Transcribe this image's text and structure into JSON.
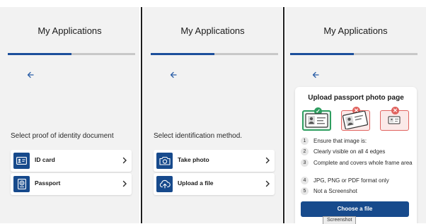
{
  "app": {
    "title": "My Applications"
  },
  "colors": {
    "primary": "#174a8c",
    "progress_track": "#c8c8c8",
    "success": "#2e9e60",
    "error": "#e0635f",
    "background": "#f2f2f2"
  },
  "screens": [
    {
      "progress": 0.5,
      "back_icon": "arrow-left-icon",
      "prompt": "Select proof of identity document",
      "options": [
        {
          "label": "ID card",
          "icon": "id-card-icon"
        },
        {
          "label": "Passport",
          "icon": "passport-icon"
        }
      ]
    },
    {
      "progress": 0.5,
      "back_icon": "arrow-left-icon",
      "prompt": "Select identification method.",
      "options": [
        {
          "label": "Take photo",
          "icon": "camera-icon"
        },
        {
          "label": "Upload a file",
          "icon": "upload-icon"
        }
      ]
    },
    {
      "progress": 0.5,
      "back_icon": "arrow-left-icon",
      "card": {
        "title": "Upload passport photo page",
        "samples": [
          {
            "status": "good",
            "badge": "✓"
          },
          {
            "status": "bad",
            "badge": "✕"
          },
          {
            "status": "bad",
            "badge": "✕"
          }
        ],
        "rules_intro": "Ensure that image is:",
        "rules": [
          {
            "num": "1",
            "text": "Ensure that image is:"
          },
          {
            "num": "2",
            "text": "Clearly visible on all 4 edges"
          },
          {
            "num": "3",
            "text": "Complete and covers whole frame area"
          },
          {
            "num": "4",
            "text": "JPG, PNG or PDF format only"
          },
          {
            "num": "5",
            "text": "Not a Screenshot"
          }
        ],
        "button": "Choose a file"
      },
      "tooltip": "Screenshot"
    }
  ]
}
